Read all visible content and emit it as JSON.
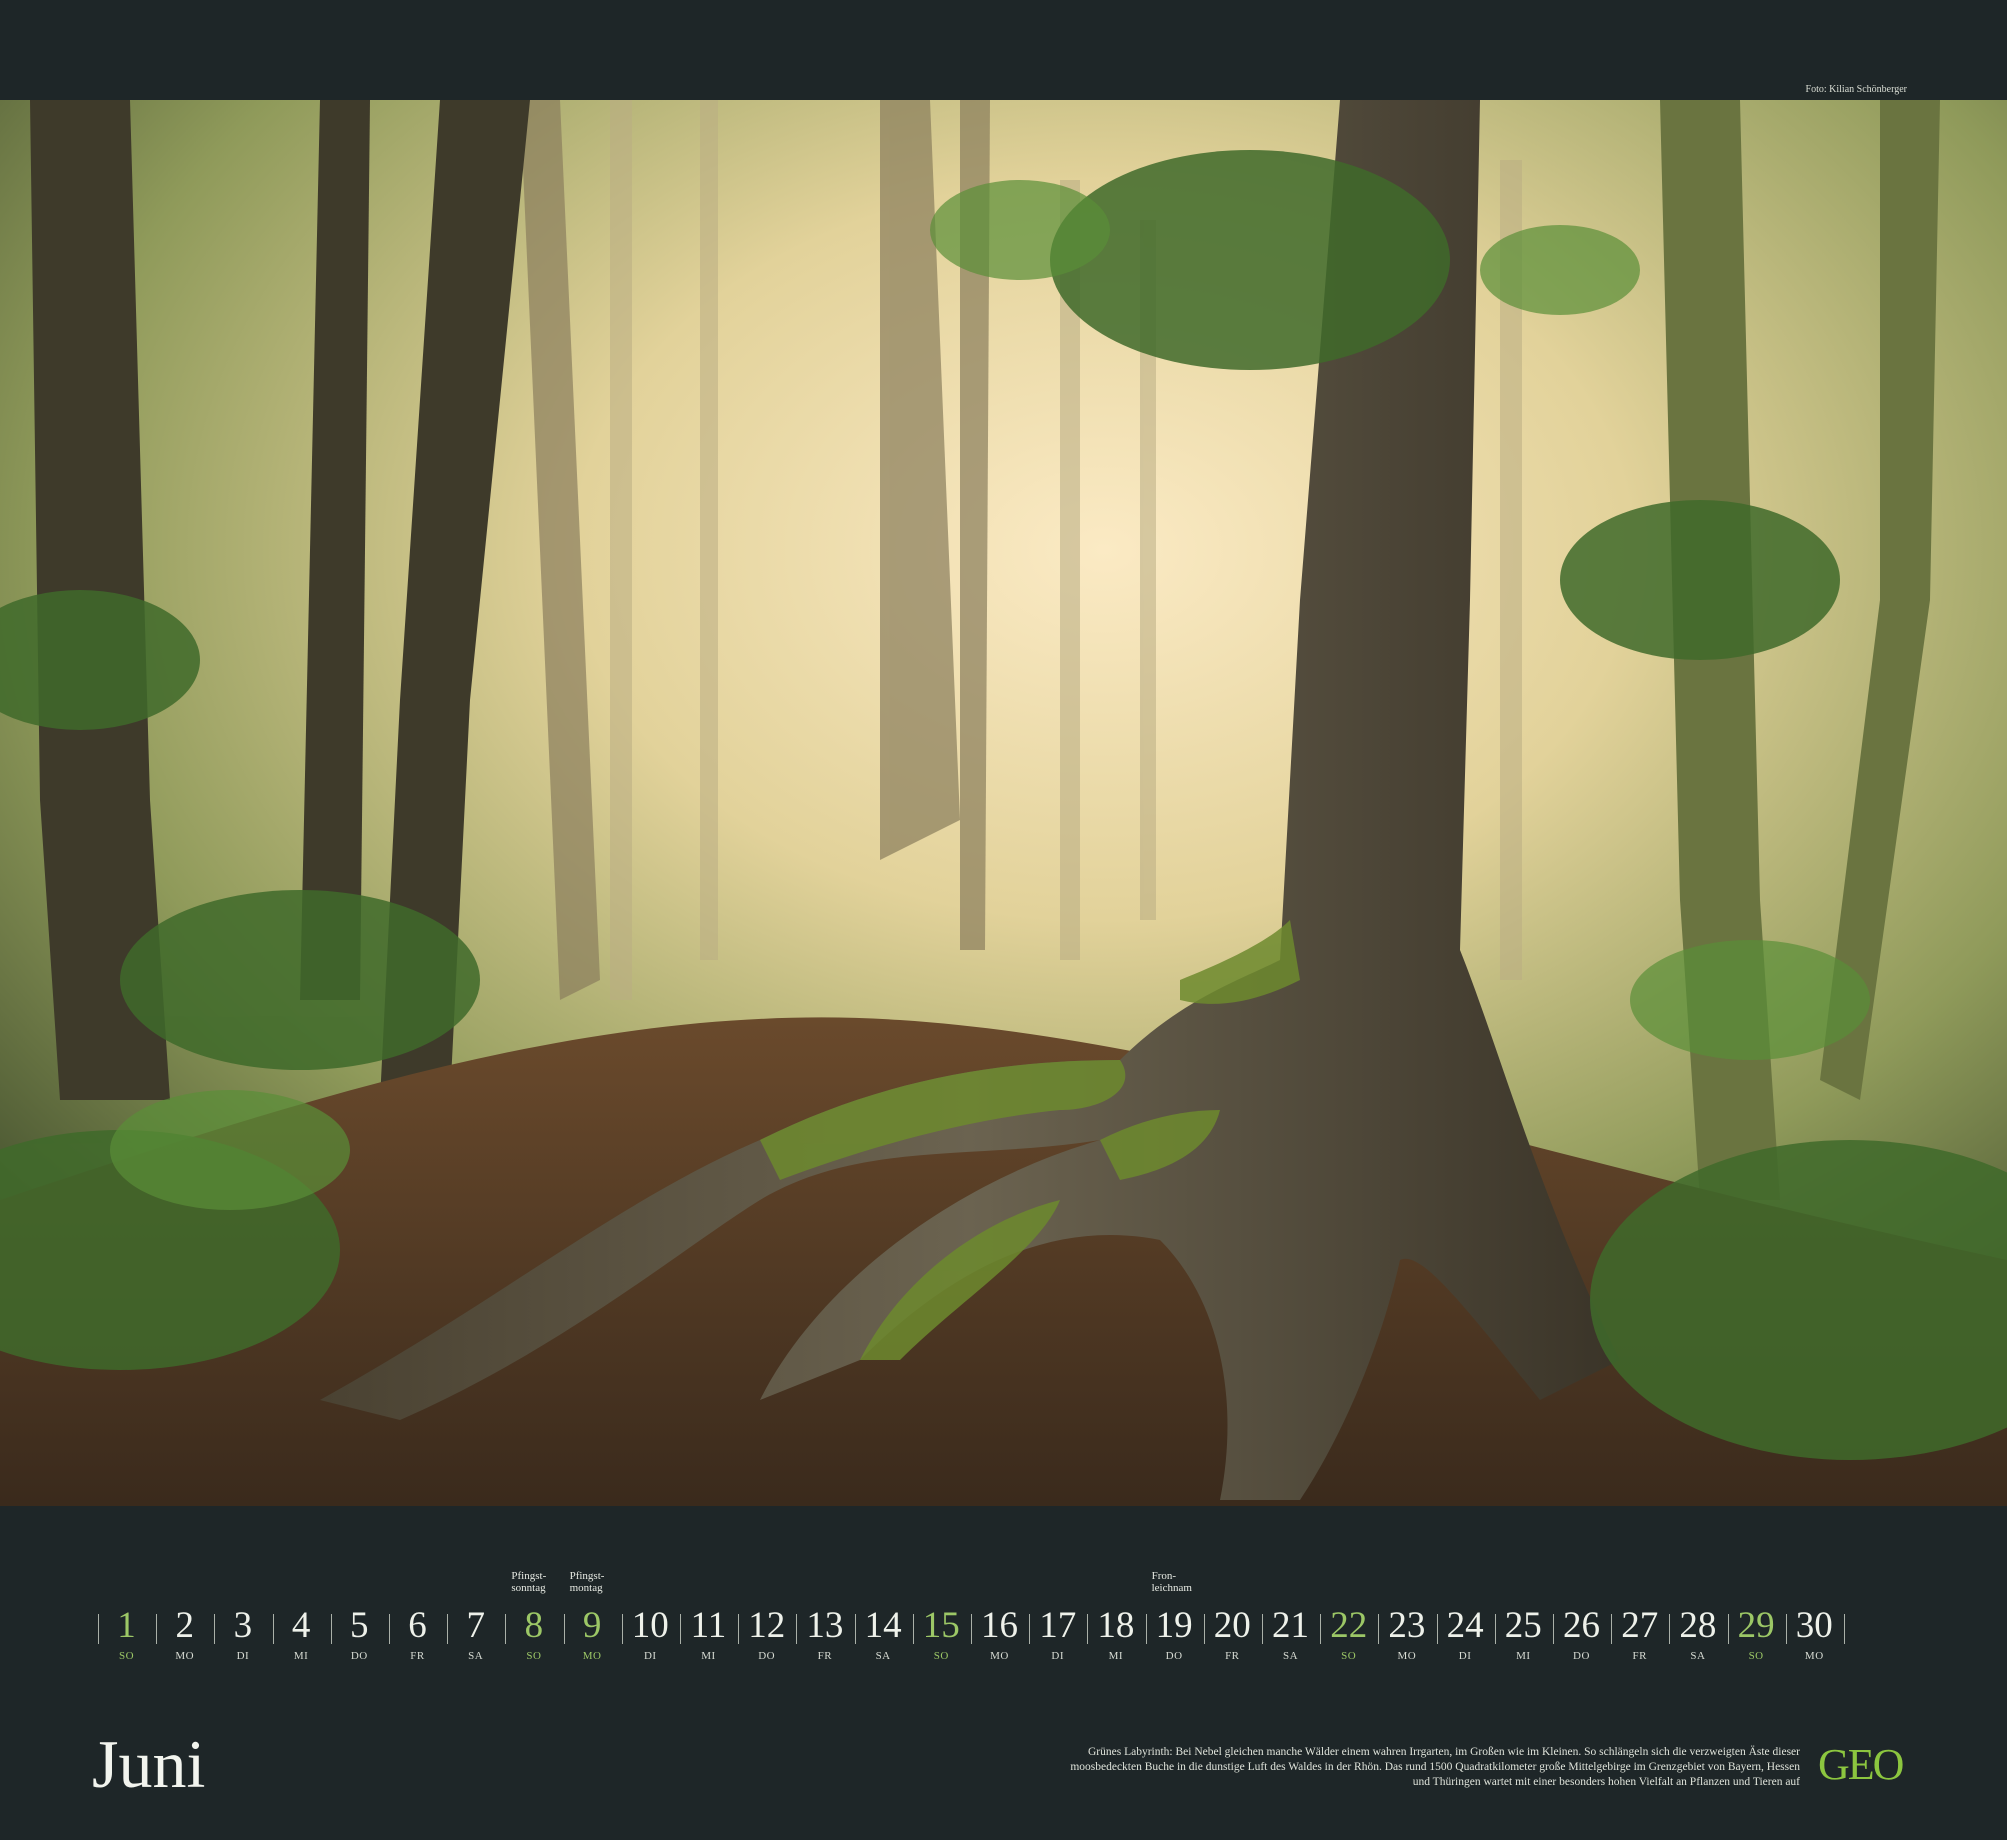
{
  "credit": "Foto: Kilian Schönberger",
  "month": "Juni",
  "days": [
    {
      "n": "1",
      "wd": "SO",
      "type": "sun",
      "note": ""
    },
    {
      "n": "2",
      "wd": "MO",
      "type": "",
      "note": ""
    },
    {
      "n": "3",
      "wd": "DI",
      "type": "",
      "note": ""
    },
    {
      "n": "4",
      "wd": "MI",
      "type": "",
      "note": ""
    },
    {
      "n": "5",
      "wd": "DO",
      "type": "",
      "note": ""
    },
    {
      "n": "6",
      "wd": "FR",
      "type": "",
      "note": ""
    },
    {
      "n": "7",
      "wd": "SA",
      "type": "",
      "note": ""
    },
    {
      "n": "8",
      "wd": "SO",
      "type": "hol",
      "note": "Pfingst-\nsonntag"
    },
    {
      "n": "9",
      "wd": "MO",
      "type": "hol",
      "note": "Pfingst-\nmontag"
    },
    {
      "n": "10",
      "wd": "DI",
      "type": "",
      "note": ""
    },
    {
      "n": "11",
      "wd": "MI",
      "type": "",
      "note": ""
    },
    {
      "n": "12",
      "wd": "DO",
      "type": "",
      "note": ""
    },
    {
      "n": "13",
      "wd": "FR",
      "type": "",
      "note": ""
    },
    {
      "n": "14",
      "wd": "SA",
      "type": "",
      "note": ""
    },
    {
      "n": "15",
      "wd": "SO",
      "type": "sun",
      "note": ""
    },
    {
      "n": "16",
      "wd": "MO",
      "type": "",
      "note": ""
    },
    {
      "n": "17",
      "wd": "DI",
      "type": "",
      "note": ""
    },
    {
      "n": "18",
      "wd": "MI",
      "type": "",
      "note": ""
    },
    {
      "n": "19",
      "wd": "DO",
      "type": "",
      "note": "Fron-\nleichnam"
    },
    {
      "n": "20",
      "wd": "FR",
      "type": "",
      "note": ""
    },
    {
      "n": "21",
      "wd": "SA",
      "type": "",
      "note": ""
    },
    {
      "n": "22",
      "wd": "SO",
      "type": "sun",
      "note": ""
    },
    {
      "n": "23",
      "wd": "MO",
      "type": "",
      "note": ""
    },
    {
      "n": "24",
      "wd": "DI",
      "type": "",
      "note": ""
    },
    {
      "n": "25",
      "wd": "MI",
      "type": "",
      "note": ""
    },
    {
      "n": "26",
      "wd": "DO",
      "type": "",
      "note": ""
    },
    {
      "n": "27",
      "wd": "FR",
      "type": "",
      "note": ""
    },
    {
      "n": "28",
      "wd": "SA",
      "type": "",
      "note": ""
    },
    {
      "n": "29",
      "wd": "SO",
      "type": "sun",
      "note": ""
    },
    {
      "n": "30",
      "wd": "MO",
      "type": "",
      "note": ""
    }
  ],
  "caption": "Grünes Labyrinth: Bei Nebel gleichen manche Wälder einem wahren Irrgarten, im Großen wie im Kleinen. So schlängeln sich die verzweigten Äste dieser moosbedeckten Buche in die dunstige Luft des Waldes in der Rhön. Das rund 1500 Quadratkilometer große Mittelgebirge im Grenzgebiet von Bayern, Hessen und Thüringen wartet mit einer besonders hohen Vielfalt an Pflanzen und Tieren auf",
  "logo": "GEO",
  "colors": {
    "background": "#1e2628",
    "sunday": "#9cc766",
    "logo": "#8cc63f"
  }
}
